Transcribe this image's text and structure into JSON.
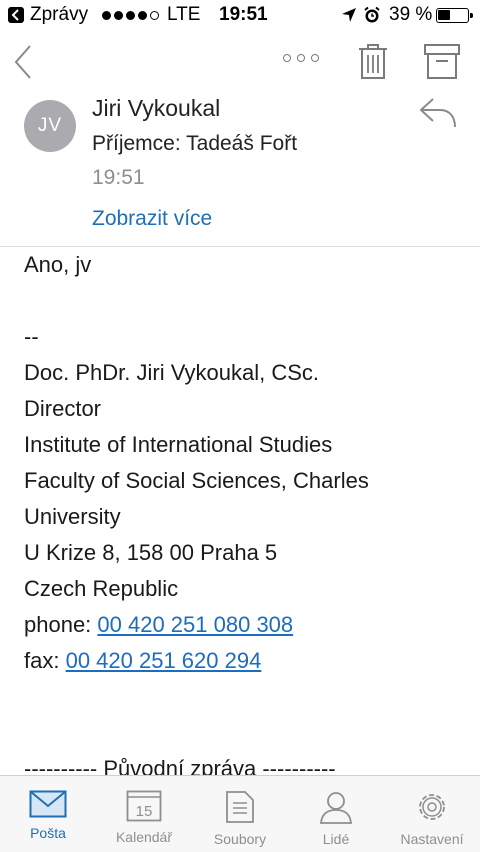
{
  "status_bar": {
    "back_app": "Zprávy",
    "network": "LTE",
    "time": "19:51",
    "battery": "39 %",
    "signal_bars_filled": 4,
    "signal_bars_total": 5
  },
  "toolbar": {
    "icons": [
      "back-chevron-icon",
      "more-icon",
      "trash-icon",
      "archive-icon"
    ]
  },
  "message": {
    "avatar_initials": "JV",
    "sender": "Jiri Vykoukal",
    "recipient": "Příjemce: Tadeáš Fořt",
    "time": "19:51",
    "show_more": "Zobrazit více",
    "greeting": "Ano, jv",
    "signature_separator": "--",
    "signature": {
      "name": "Doc. PhDr. Jiri Vykoukal, CSc.",
      "title": "Director",
      "org1": "Institute of International Studies",
      "org2a": "Faculty of Social Sciences, Charles",
      "org2b": "University",
      "address": "U Krize 8, 158 00 Praha 5",
      "country": "Czech Republic",
      "phone_label": "phone: ",
      "phone": "00 420 251 080 308",
      "fax_label": "fax: ",
      "fax": "00 420 251 620 294"
    },
    "original_header": "---------- Původní zpráva ----------"
  },
  "tabs": [
    {
      "label": "Pošta",
      "icon": "mail-icon",
      "active": true
    },
    {
      "label": "Kalendář",
      "icon": "calendar-icon",
      "day": "15",
      "active": false
    },
    {
      "label": "Soubory",
      "icon": "files-icon",
      "active": false
    },
    {
      "label": "Lidé",
      "icon": "people-icon",
      "active": false
    },
    {
      "label": "Nastavení",
      "icon": "gear-icon",
      "active": false
    }
  ],
  "colors": {
    "accent": "#1f6fb4",
    "link": "#1c6cc0",
    "inactive_tab": "#8e8e93",
    "avatar_bg": "#aaaaaf"
  }
}
